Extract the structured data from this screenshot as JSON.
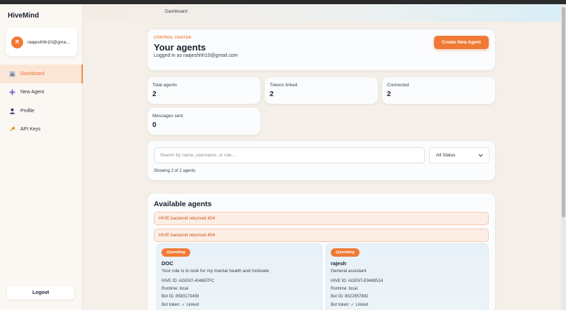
{
  "app": {
    "brand": "HiveMind"
  },
  "user": {
    "initial": "R",
    "email": "raajeshhh10@gma..."
  },
  "nav": [
    {
      "label": "Dashboard",
      "icon": "bar-chart-icon",
      "glyph": "▮",
      "active": true
    },
    {
      "label": "New Agent",
      "icon": "plus-icon",
      "glyph": "+",
      "active": false
    },
    {
      "label": "Profile",
      "icon": "person-icon",
      "glyph": "●",
      "active": false
    },
    {
      "label": "API Keys",
      "icon": "key-icon",
      "glyph": "⚷",
      "active": false
    }
  ],
  "sidebar": {
    "logout_label": "Logout"
  },
  "header": {
    "breadcrumb": "Dashboard"
  },
  "control_center": {
    "kicker": "CONTROL CENTER",
    "title": "Your agents",
    "subtitle": "Logged in as raajeshhh10@gmail.com",
    "create_label": "Create New Agent"
  },
  "stats": [
    {
      "label": "Total agents",
      "value": "2"
    },
    {
      "label": "Tokens linked",
      "value": "2"
    },
    {
      "label": "Connected",
      "value": "2"
    },
    {
      "label": "Messages sent",
      "value": "0"
    }
  ],
  "filters": {
    "search_placeholder": "Search by name, username, or role...",
    "status_value": "All Status",
    "showing": "Showing 2 of 2 agents"
  },
  "agents_panel": {
    "title": "Available agents",
    "errors": [
      "HIVE backend returned 404",
      "HIVE backend returned 404"
    ]
  },
  "agents": [
    {
      "status": "@pending",
      "name": "DOC",
      "description": "Your role is to look for my mental health and motivate",
      "hive_id": "HIVE ID: AGENT-404887FC",
      "runtime": "Runtime: local",
      "bot_id": "Bot ID: 8583173459",
      "bot_token": "Bot token: ✓ Linked"
    },
    {
      "status": "@pending",
      "name": "rajesh",
      "description": "General assistant",
      "hive_id": "HIVE ID: AGENT-E9489514",
      "runtime": "Runtime: local",
      "bot_id": "Bot ID: 8022857892",
      "bot_token": "Bot token: ✓ Linked"
    }
  ],
  "colors": {
    "accent": "#f07a35",
    "active_nav_bg": "#fbe6d6",
    "error_text": "#c4541c"
  }
}
